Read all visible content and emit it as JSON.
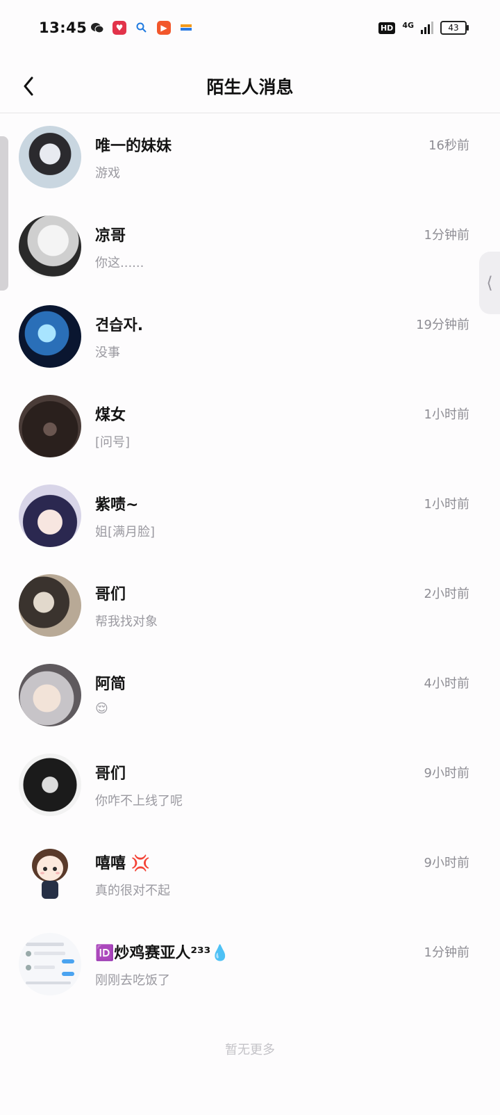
{
  "status_bar": {
    "time": "13:45",
    "battery": "43",
    "network": "4G",
    "hd": "HD"
  },
  "header": {
    "title": "陌生人消息",
    "back_icon": "chevron-left-icon"
  },
  "conversations": [
    {
      "name": "唯一的妹妹",
      "preview": "游戏",
      "time": "16秒前"
    },
    {
      "name": "凉哥",
      "preview": "你这......",
      "time": "1分钟前"
    },
    {
      "name": "견습자.",
      "preview": "没事",
      "time": "19分钟前"
    },
    {
      "name": "煤女",
      "preview": "[问号]",
      "time": "1小时前"
    },
    {
      "name": "紫啧~",
      "preview": "姐[满月脸]",
      "time": "1小时前"
    },
    {
      "name": "哥们",
      "preview": "帮我找对象",
      "time": "2小时前"
    },
    {
      "name": "阿简",
      "preview": "😌",
      "time": "4小时前"
    },
    {
      "name": "哥们",
      "preview": "你咋不上线了呢",
      "time": "9小时前"
    },
    {
      "name": "嘻嘻 💢",
      "preview": "真的很对不起",
      "time": "9小时前"
    },
    {
      "name": "🆔炒鸡赛亚人²³³💧",
      "preview": "刚刚去吃饭了",
      "time": "1分钟前"
    }
  ],
  "footer": {
    "no_more": "暂无更多"
  },
  "colors": {
    "background": "#fdfcfd",
    "title": "#111111",
    "preview": "#9b9aa1",
    "time": "#8e8d94"
  }
}
